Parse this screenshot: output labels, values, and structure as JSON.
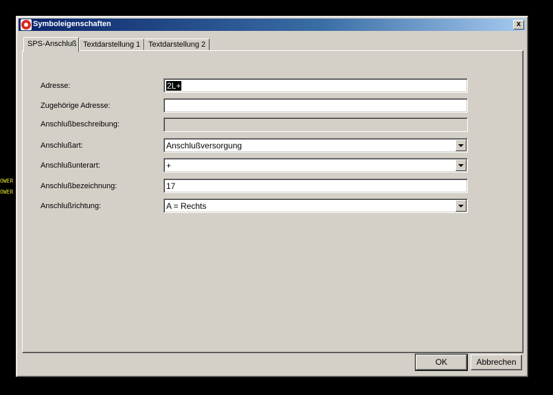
{
  "background": {
    "label_1": "OWER",
    "label_2": "OWER"
  },
  "window": {
    "title": "Symboleigenschaften",
    "close_label": "x"
  },
  "tabs": [
    {
      "label": "SPS-Anschluß"
    },
    {
      "label": "Textdarstellung 1"
    },
    {
      "label": "Textdarstellung 2"
    }
  ],
  "form": {
    "adresse": {
      "label": "Adresse:",
      "value": "2L+"
    },
    "zugehoerige_adresse": {
      "label": "Zugehörige Adresse:",
      "value": ""
    },
    "anschlussbeschreibung": {
      "label": "Anschlußbeschreibung:",
      "value": ""
    },
    "anschlussart": {
      "label": "Anschlußart:",
      "value": "Anschlußversorgung"
    },
    "anschlussunterart": {
      "label": "Anschlußunterart:",
      "value": "+"
    },
    "anschlussbezeichnung": {
      "label": "Anschlußbezeichnung:",
      "value": "17"
    },
    "anschlussrichtung": {
      "label": "Anschlußrichtung:",
      "value": "A = Rechts"
    }
  },
  "buttons": {
    "ok_label": "OK",
    "cancel_label": "Abbrechen"
  }
}
